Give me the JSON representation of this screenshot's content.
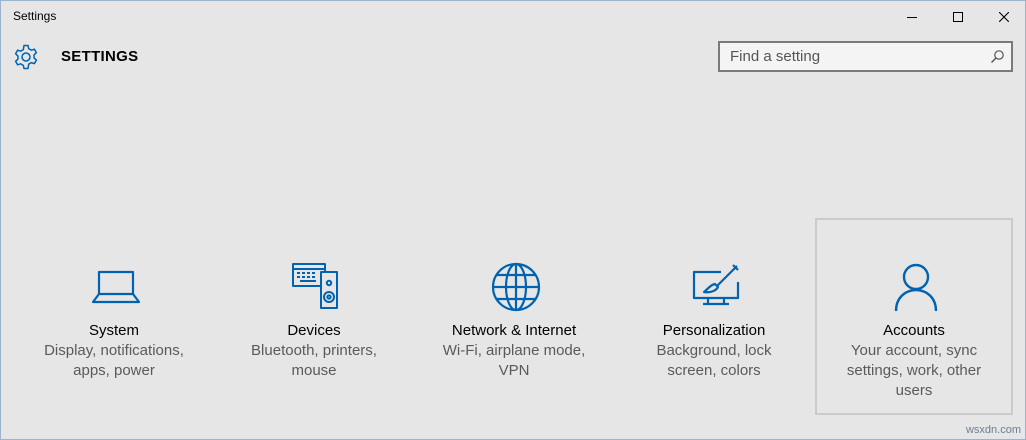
{
  "window": {
    "title": "Settings",
    "controls": {
      "minimize_icon": "minimize-icon",
      "maximize_icon": "maximize-icon",
      "close_icon": "close-icon"
    }
  },
  "header": {
    "icon": "gear-icon",
    "title": "SETTINGS"
  },
  "search": {
    "placeholder": "Find a setting",
    "value": "",
    "icon": "search-icon"
  },
  "accent_color": "#0063b1",
  "categories": [
    {
      "label": "System",
      "description": "Display, notifications, apps, power",
      "icon": "laptop-icon",
      "selected": false
    },
    {
      "label": "Devices",
      "description": "Bluetooth, printers, mouse",
      "icon": "devices-icon",
      "selected": false
    },
    {
      "label": "Network & Internet",
      "description": "Wi-Fi, airplane mode, VPN",
      "icon": "globe-icon",
      "selected": false
    },
    {
      "label": "Personalization",
      "description": "Background, lock screen, colors",
      "icon": "paintbrush-icon",
      "selected": false
    },
    {
      "label": "Accounts",
      "description": "Your account, sync settings, work, other users",
      "icon": "person-icon",
      "selected": true
    }
  ],
  "watermark": "wsxdn.com"
}
